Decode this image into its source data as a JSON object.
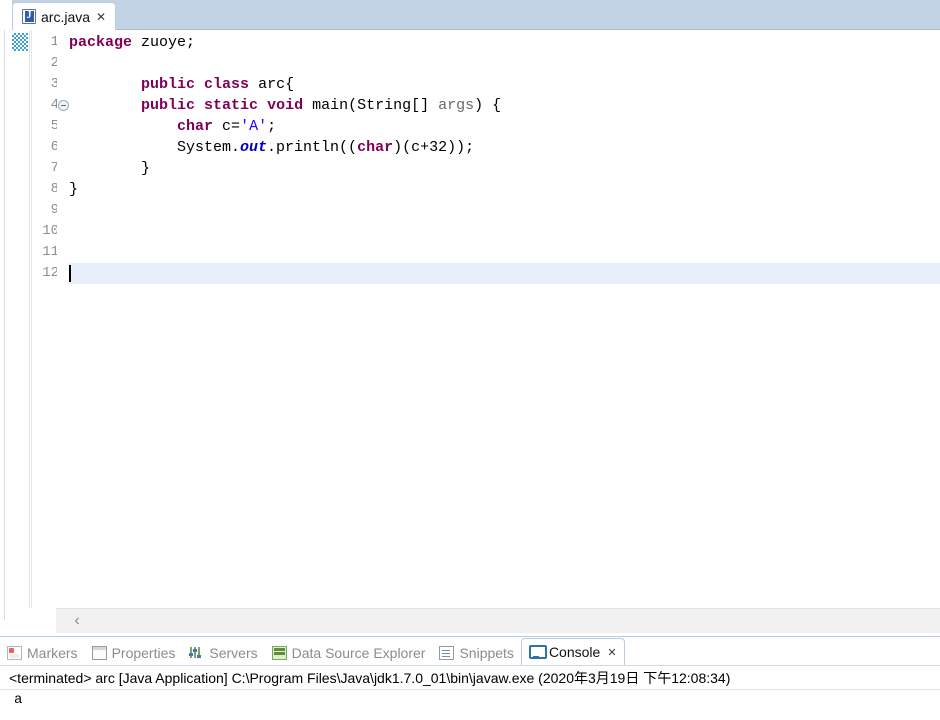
{
  "editor": {
    "tab": {
      "icon": "java-file-icon",
      "title": "arc.java",
      "close": "✕"
    },
    "gutter": {
      "line_numbers": [
        "1",
        "2",
        "3",
        "4",
        "5",
        "6",
        "7",
        "8",
        "9",
        "10",
        "11",
        "12"
      ],
      "fold_marker_line": 4,
      "annotation_marker_line": 1
    },
    "current_line": 12,
    "code_lines": [
      {
        "number": 1,
        "tokens": [
          {
            "t": "package",
            "c": "kw"
          },
          {
            "t": " zuoye;",
            "c": "plain"
          }
        ]
      },
      {
        "number": 2,
        "tokens": []
      },
      {
        "number": 3,
        "tokens": [
          {
            "t": "        ",
            "c": "plain"
          },
          {
            "t": "public",
            "c": "kw"
          },
          {
            "t": " ",
            "c": "plain"
          },
          {
            "t": "class",
            "c": "kw"
          },
          {
            "t": " arc{",
            "c": "plain"
          }
        ]
      },
      {
        "number": 4,
        "tokens": [
          {
            "t": "        ",
            "c": "plain"
          },
          {
            "t": "public",
            "c": "kw"
          },
          {
            "t": " ",
            "c": "plain"
          },
          {
            "t": "static",
            "c": "kw"
          },
          {
            "t": " ",
            "c": "plain"
          },
          {
            "t": "void",
            "c": "kw"
          },
          {
            "t": " main(String[] ",
            "c": "plain"
          },
          {
            "t": "args",
            "c": "prm"
          },
          {
            "t": ") {",
            "c": "plain"
          }
        ]
      },
      {
        "number": 5,
        "tokens": [
          {
            "t": "            ",
            "c": "plain"
          },
          {
            "t": "char",
            "c": "kw"
          },
          {
            "t": " c=",
            "c": "plain"
          },
          {
            "t": "'A'",
            "c": "str"
          },
          {
            "t": ";",
            "c": "plain"
          }
        ]
      },
      {
        "number": 6,
        "tokens": [
          {
            "t": "            System.",
            "c": "plain"
          },
          {
            "t": "out",
            "c": "fld"
          },
          {
            "t": ".println((",
            "c": "plain"
          },
          {
            "t": "char",
            "c": "kw"
          },
          {
            "t": ")(c+32));",
            "c": "plain"
          }
        ]
      },
      {
        "number": 7,
        "tokens": [
          {
            "t": "        }",
            "c": "plain"
          }
        ]
      },
      {
        "number": 8,
        "tokens": [
          {
            "t": "}",
            "c": "plain"
          }
        ]
      },
      {
        "number": 9,
        "tokens": []
      },
      {
        "number": 10,
        "tokens": []
      },
      {
        "number": 11,
        "tokens": []
      },
      {
        "number": 12,
        "tokens": []
      }
    ],
    "scrollbar": {
      "left_arrow": "‹"
    }
  },
  "bottom_view": {
    "tabs": [
      {
        "label": "Markers",
        "icon": "markers-icon",
        "active": false
      },
      {
        "label": "Properties",
        "icon": "properties-icon",
        "active": false
      },
      {
        "label": "Servers",
        "icon": "servers-icon",
        "active": false
      },
      {
        "label": "Data Source Explorer",
        "icon": "data-source-explorer-icon",
        "active": false
      },
      {
        "label": "Snippets",
        "icon": "snippets-icon",
        "active": false
      },
      {
        "label": "Console",
        "icon": "console-icon",
        "active": true,
        "close": "✕"
      }
    ],
    "console": {
      "header": "<terminated> arc [Java Application] C:\\Program Files\\Java\\jdk1.7.0_01\\bin\\javaw.exe (2020年3月19日 下午12:08:34)",
      "output": "a"
    }
  },
  "colors": {
    "keyword": "#7f0055",
    "string": "#2a00ff",
    "field": "#0000c0",
    "parameter": "#6a6a6a",
    "tab_bar": "#c3d3e6",
    "current_line": "#e8eefa",
    "annotation": "#3a9ed8"
  }
}
